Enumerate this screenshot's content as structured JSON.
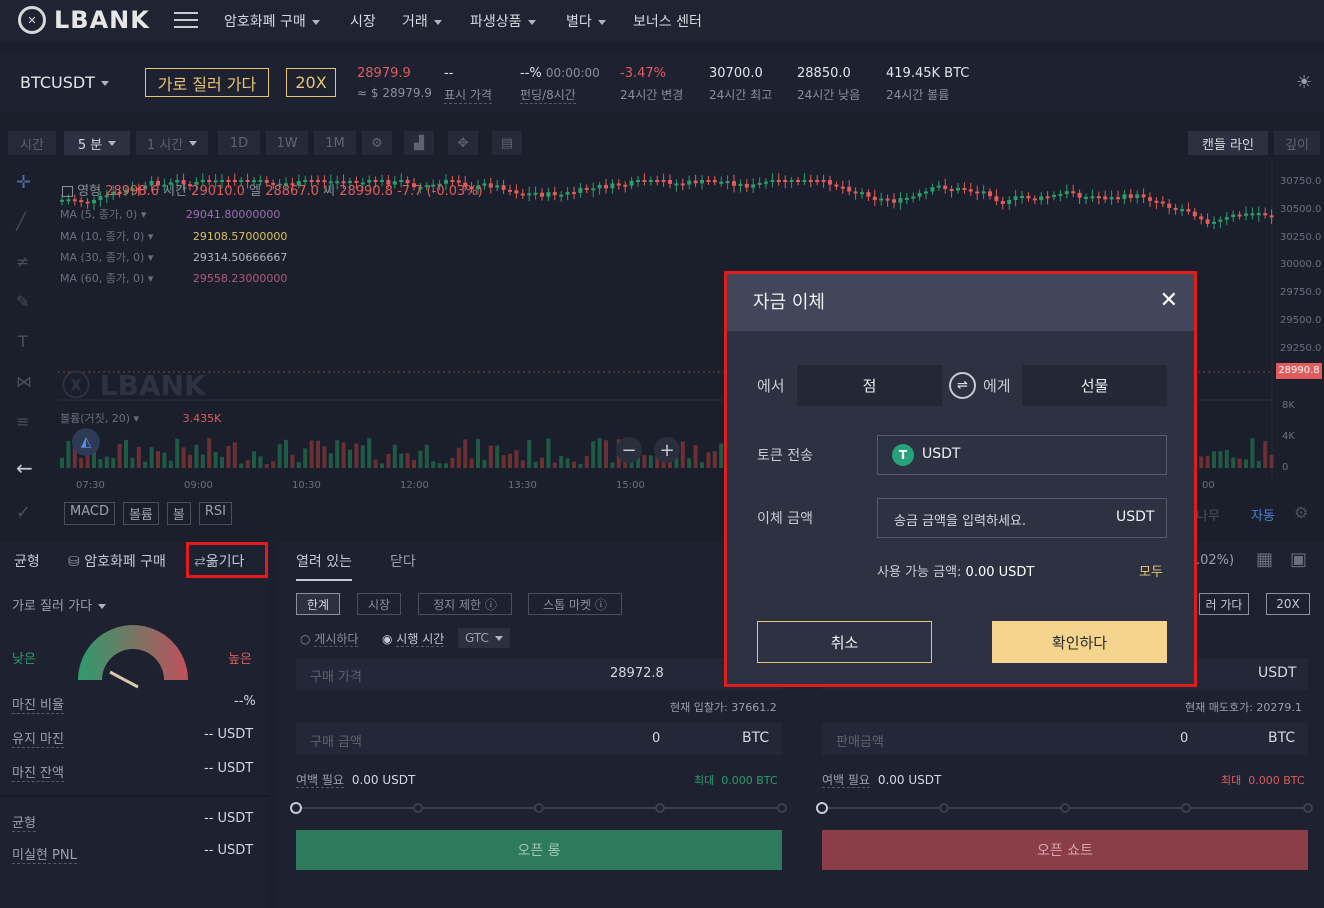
{
  "nav": {
    "logo": "LBANK",
    "items": [
      "암호화폐 구매",
      "시장",
      "거래",
      "파생상품",
      "별다",
      "보너스 센터"
    ]
  },
  "ticker": {
    "symbol": "BTCUSDT",
    "cross_btn": "가로 질러 가다",
    "leverage_btn": "20X",
    "last_price": "28979.9",
    "last_price_usd": "≈ $ 28979.9",
    "mark_price": "--",
    "mark_label": "표시 가격",
    "funding": "--%",
    "funding_time": "00:00:00",
    "funding_label": "펀딩/8시간",
    "change": "-3.47%",
    "change_label": "24시간 변경",
    "high": "30700.0",
    "high_label": "24시간 최고",
    "low": "28850.0",
    "low_label": "24시간 낮음",
    "volume": "419.45K BTC",
    "volume_label": "24시간 볼륨"
  },
  "chart_toolbar": {
    "time": "시간",
    "interval": "5 분",
    "hour": "1 시간",
    "d1": "1D",
    "w1": "1W",
    "m1": "1M",
    "candle": "캔들 라인",
    "depth": "깊이"
  },
  "chart": {
    "ohlc_open_label": "영형",
    "ohlc_open": "28998.6",
    "ohlc_high_label": "시간",
    "ohlc_high": "29010.0",
    "ohlc_low_label": "엘",
    "ohlc_low": "28867.0",
    "ohlc_close_label": "씨",
    "ohlc_close": "28990.8",
    "ohlc_change": "-7.7 (-0.03%)",
    "ma5": "MA (5, 종가, 0)",
    "ma5_val": "29041.80000000",
    "ma10": "MA (10, 종가, 0)",
    "ma10_val": "29108.57000000",
    "ma30": "MA (30, 종가, 0)",
    "ma30_val": "29314.50666667",
    "ma60": "MA (60, 종가, 0)",
    "ma60_val": "29558.23000000",
    "volume_label": "볼륨(거짓, 20)",
    "volume_val": "3.435K",
    "price_axis": [
      "30750.0",
      "30500.0",
      "30250.0",
      "30000.0",
      "29750.0",
      "29500.0",
      "29250.0",
      "28990.8"
    ],
    "vol_axis": [
      "8K",
      "4K",
      "0"
    ],
    "time_axis": [
      "07:30",
      "09:00",
      "10:30",
      "12:00",
      "13:30",
      "15:00",
      "00"
    ],
    "indicators": [
      "MACD",
      "볼륨",
      "볼",
      "RSI"
    ],
    "auto": "자동",
    "tree": "나무"
  },
  "left_panel": {
    "tabs": [
      "균형",
      "암호화페 구매",
      "옮기다"
    ],
    "mode": "가로 질러 가다",
    "low": "낮은",
    "high": "높은",
    "margin_ratio_label": "마진 비율",
    "margin_ratio": "--%",
    "maint_margin_label": "유지 마진",
    "maint_margin": "-- USDT",
    "margin_balance_label": "마진 잔액",
    "margin_balance": "-- USDT",
    "balance_label": "균형",
    "balance": "-- USDT",
    "pnl_label": "미실현 PNL",
    "pnl": "-- USDT"
  },
  "order": {
    "tab_open": "열려 있는",
    "tab_close": "닫다",
    "types": [
      "한계",
      "시장",
      "정지 제한",
      "스톱 마켓"
    ],
    "post": "게시하다",
    "tif": "시행 시간",
    "gtc": "GTC",
    "buy_price_label": "구매 가격",
    "buy_price": "28972.8",
    "buy_hint": "현재 입찰가: 37661.2",
    "sell_hint": "현재 매도호가: 20279.1",
    "sell_currency": "USDT",
    "buy_amount_label": "구매 금액",
    "buy_amount": "0",
    "sell_amount_label": "판매금액",
    "sell_amount": "0",
    "btc": "BTC",
    "margin_req_label": "여백 필요",
    "margin_req": "0.00 USDT",
    "max_label": "최대",
    "max_val": "0.000 BTC",
    "open_long": "오픈 롱",
    "open_short": "오픈 쇼트",
    "fee_tail": ".02%)",
    "cross_small": "러 가다",
    "lev_small": "20X"
  },
  "modal": {
    "title": "자금 이체",
    "from_label": "에서",
    "from_value": "점",
    "to_label": "에게",
    "to_value": "선물",
    "token_label": "토큰 전송",
    "token_value": "USDT",
    "amount_label": "이체 금액",
    "amount_placeholder": "송금 금액을 입력하세요.",
    "amount_unit": "USDT",
    "available_label": "사용 가능 금액:",
    "available_value": "0.00 USDT",
    "all": "모두",
    "cancel": "취소",
    "confirm": "확인하다"
  },
  "colors": {
    "accent": "#e7c572",
    "up": "#2e9b6d",
    "down": "#e05c5c",
    "highlight": "#e01c1c"
  }
}
